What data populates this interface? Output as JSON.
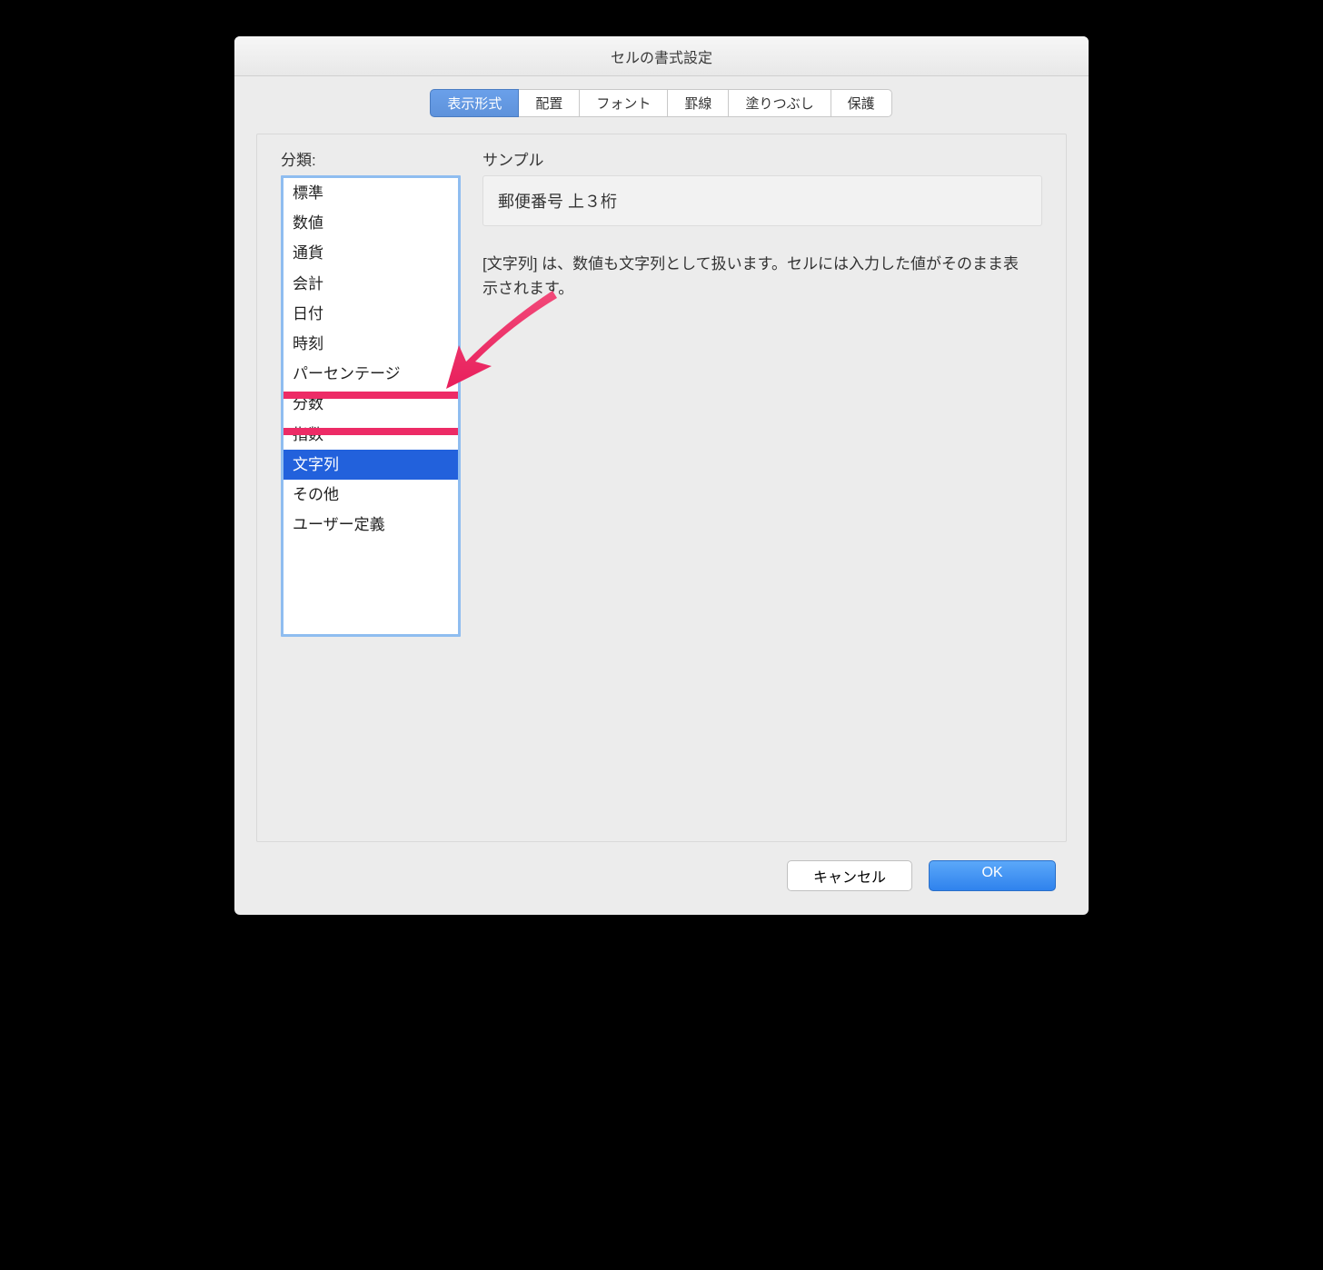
{
  "window": {
    "title": "セルの書式設定"
  },
  "tabs": [
    {
      "label": "表示形式",
      "active": true
    },
    {
      "label": "配置",
      "active": false
    },
    {
      "label": "フォント",
      "active": false
    },
    {
      "label": "罫線",
      "active": false
    },
    {
      "label": "塗りつぶし",
      "active": false
    },
    {
      "label": "保護",
      "active": false
    }
  ],
  "category": {
    "label": "分類:",
    "items": [
      "標準",
      "数値",
      "通貨",
      "会計",
      "日付",
      "時刻",
      "パーセンテージ",
      "分数",
      "指数",
      "文字列",
      "その他",
      "ユーザー定義"
    ],
    "selected_index": 9
  },
  "sample": {
    "label": "サンプル",
    "value": "郵便番号 上３桁"
  },
  "description": "[文字列] は、数値も文字列として扱います。セルには入力した値がそのまま表示されます。",
  "buttons": {
    "cancel": "キャンセル",
    "ok": "OK"
  },
  "annotation": {
    "highlight_color": "#ed2b66"
  }
}
